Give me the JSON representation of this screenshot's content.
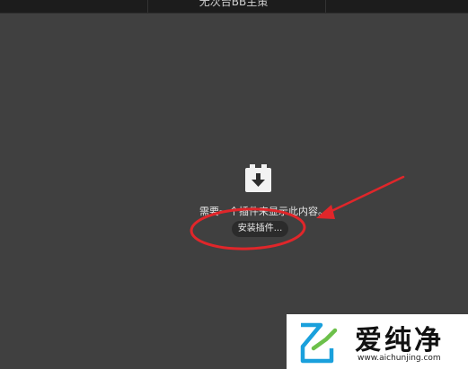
{
  "window": {
    "title": "无次台BB主策"
  },
  "plugin": {
    "icon": "plugin-download-icon",
    "message": "需要一个插件来显示此内容。",
    "install_label": "安装插件..."
  },
  "annotation": {
    "color": "#e0262a"
  },
  "watermark": {
    "brand": "爱纯净",
    "url": "www.aichunjing.com"
  }
}
